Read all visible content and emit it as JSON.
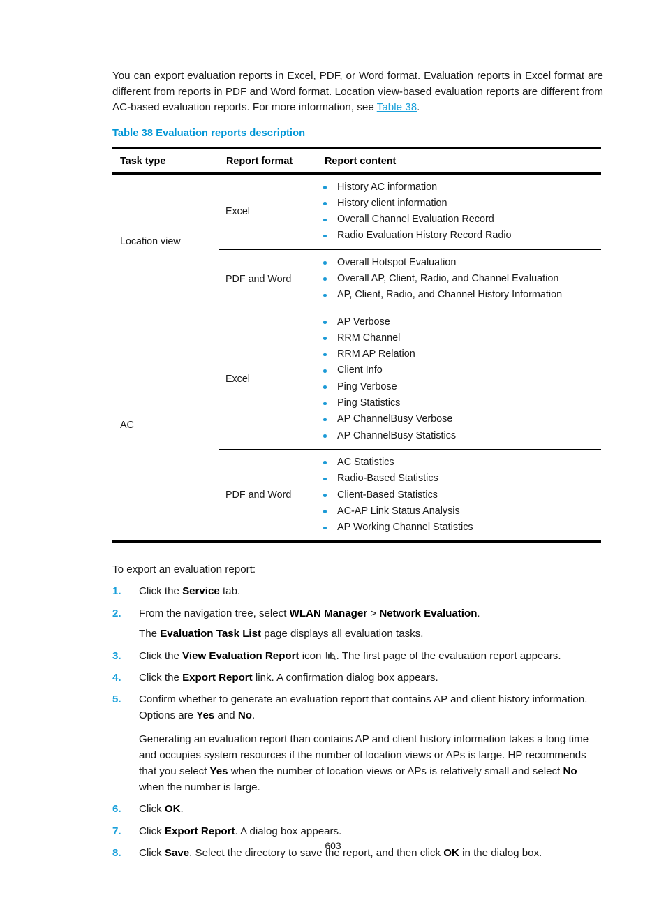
{
  "document": {
    "page_number": "603",
    "intro_paragraph": {
      "part1": "You can export evaluation reports in Excel, PDF, or Word format. Evaluation reports in Excel format are different from reports in PDF and Word format. Location view-based evaluation reports are different from AC-based evaluation reports. For more information, see ",
      "xref": "Table 38",
      "part2": "."
    },
    "table_caption": "Table 38 Evaluation reports description"
  },
  "table": {
    "headers": {
      "task_type": "Task type",
      "report_format": "Report format",
      "report_content": "Report content"
    },
    "rows": [
      {
        "task_type": "Location view",
        "formats": [
          {
            "format": "Excel",
            "content": [
              "History AC information",
              "History client information",
              "Overall Channel Evaluation Record",
              "Radio Evaluation History Record Radio"
            ]
          },
          {
            "format": "PDF and Word",
            "content": [
              "Overall Hotspot Evaluation",
              "Overall AP, Client, Radio, and Channel Evaluation",
              "AP, Client, Radio, and Channel History Information"
            ]
          }
        ]
      },
      {
        "task_type": "AC",
        "formats": [
          {
            "format": "Excel",
            "content": [
              "AP Verbose",
              "RRM Channel",
              "RRM AP Relation",
              "Client Info",
              "Ping Verbose",
              "Ping Statistics",
              "AP ChannelBusy Verbose",
              "AP ChannelBusy Statistics"
            ]
          },
          {
            "format": "PDF and Word",
            "content": [
              "AC Statistics",
              "Radio-Based Statistics",
              "Client-Based Statistics",
              "AC-AP Link Status Analysis",
              "AP Working Channel Statistics"
            ]
          }
        ]
      }
    ]
  },
  "procedure": {
    "lead_in": "To export an evaluation report:",
    "steps": [
      {
        "number": "1.",
        "segments": [
          {
            "text": "Click the ",
            "bold": false
          },
          {
            "text": "Service",
            "bold": true
          },
          {
            "text": " tab.",
            "bold": false
          }
        ]
      },
      {
        "number": "2.",
        "segments": [
          {
            "text": "From the navigation tree, select ",
            "bold": false
          },
          {
            "text": "WLAN Manager",
            "bold": true
          },
          {
            "text": " > ",
            "bold": false
          },
          {
            "text": "Network Evaluation",
            "bold": true
          },
          {
            "text": ".",
            "bold": false
          }
        ],
        "substep_segments": [
          {
            "text": "The ",
            "bold": false
          },
          {
            "text": "Evaluation Task List",
            "bold": true
          },
          {
            "text": " page displays all evaluation tasks.",
            "bold": false
          }
        ]
      },
      {
        "number": "3.",
        "segments": [
          {
            "text": "Click the ",
            "bold": false
          },
          {
            "text": "View Evaluation Report",
            "bold": true
          },
          {
            "text": " icon ",
            "bold": false
          },
          {
            "icon": "view-evaluation-report-icon"
          },
          {
            "text": ". The first page of the evaluation report appears.",
            "bold": false
          }
        ]
      },
      {
        "number": "4.",
        "segments": [
          {
            "text": "Click the ",
            "bold": false
          },
          {
            "text": "Export Report",
            "bold": true
          },
          {
            "text": " link. A confirmation dialog box appears.",
            "bold": false
          }
        ]
      },
      {
        "number": "5.",
        "segments": [
          {
            "text": "Confirm whether to generate an evaluation report that contains AP and client history information. Options are ",
            "bold": false
          },
          {
            "text": "Yes",
            "bold": true
          },
          {
            "text": " and ",
            "bold": false
          },
          {
            "text": "No",
            "bold": true
          },
          {
            "text": ".",
            "bold": false
          }
        ],
        "note_segments": [
          {
            "text": "Generating an evaluation report than contains AP and client history information takes a long time and occupies system resources if the number of location views or APs is large. HP recommends that you select ",
            "bold": false
          },
          {
            "text": "Yes",
            "bold": true
          },
          {
            "text": " when the number of location views or APs is relatively small and select ",
            "bold": false
          },
          {
            "text": "No",
            "bold": true
          },
          {
            "text": " when the number is large.",
            "bold": false
          }
        ]
      },
      {
        "number": "6.",
        "segments": [
          {
            "text": "Click ",
            "bold": false
          },
          {
            "text": "OK",
            "bold": true
          },
          {
            "text": ".",
            "bold": false
          }
        ]
      },
      {
        "number": "7.",
        "segments": [
          {
            "text": "Click ",
            "bold": false
          },
          {
            "text": "Export Report",
            "bold": true
          },
          {
            "text": ". A dialog box appears.",
            "bold": false
          }
        ]
      },
      {
        "number": "8.",
        "segments": [
          {
            "text": "Click ",
            "bold": false
          },
          {
            "text": "Save",
            "bold": true
          },
          {
            "text": ". Select the directory to save the report, and then click ",
            "bold": false
          },
          {
            "text": "OK",
            "bold": true
          },
          {
            "text": " in the dialog box.",
            "bold": false
          }
        ]
      }
    ]
  },
  "colors": {
    "accent_blue": "#0096d6",
    "link_blue": "#1aa0da",
    "bullet_blue": "#1c9ad6",
    "text_black": "#1a1a1a"
  }
}
